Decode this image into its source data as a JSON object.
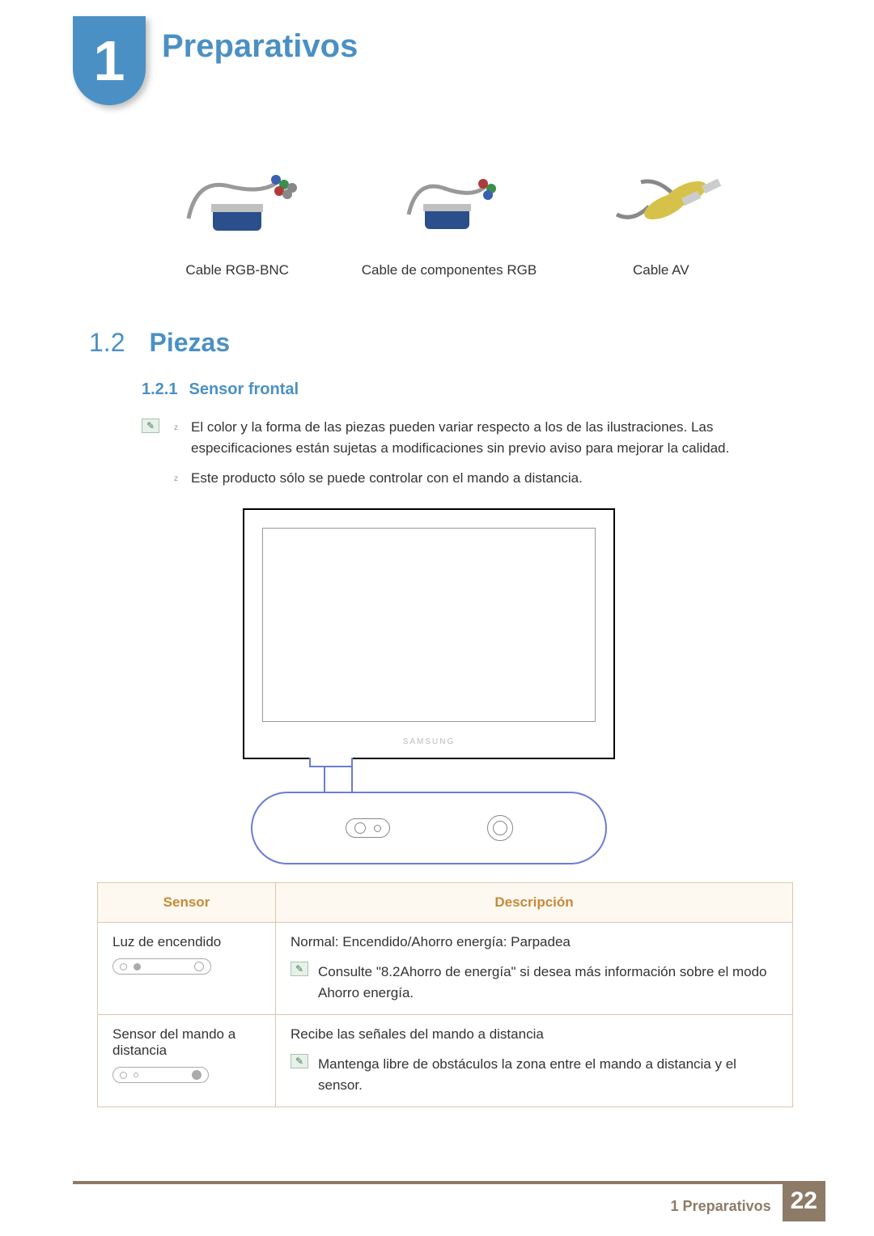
{
  "chapter": {
    "number": "1",
    "title": "Preparativos"
  },
  "cables": [
    {
      "caption": "Cable RGB-BNC"
    },
    {
      "caption": "Cable de componentes RGB"
    },
    {
      "caption": "Cable AV"
    }
  ],
  "section": {
    "number": "1.2",
    "title": "Piezas"
  },
  "subsection": {
    "number": "1.2.1",
    "title": "Sensor frontal"
  },
  "notes": [
    "El color y la forma de las piezas pueden variar respecto a los de las ilustraciones. Las especificaciones están sujetas a modificaciones sin previo aviso para mejorar la calidad.",
    "Este producto sólo se puede controlar con el mando a distancia."
  ],
  "monitor": {
    "brand": "SAMSUNG"
  },
  "table": {
    "headers": {
      "sensor": "Sensor",
      "description": "Descripción"
    },
    "rows": [
      {
        "sensor": "Luz de encendido",
        "desc": "Normal: Encendido/Ahorro energía: Parpadea",
        "note": "Consulte \"8.2Ahorro de energía\" si desea más información sobre el modo Ahorro energía."
      },
      {
        "sensor": "Sensor del mando a distancia",
        "desc": "Recibe las señales del mando a distancia",
        "note": "Mantenga libre de obstáculos la zona entre el mando a distancia y el sensor."
      }
    ]
  },
  "footer": {
    "chapter_ref": "1 Preparativos",
    "page": "22"
  }
}
